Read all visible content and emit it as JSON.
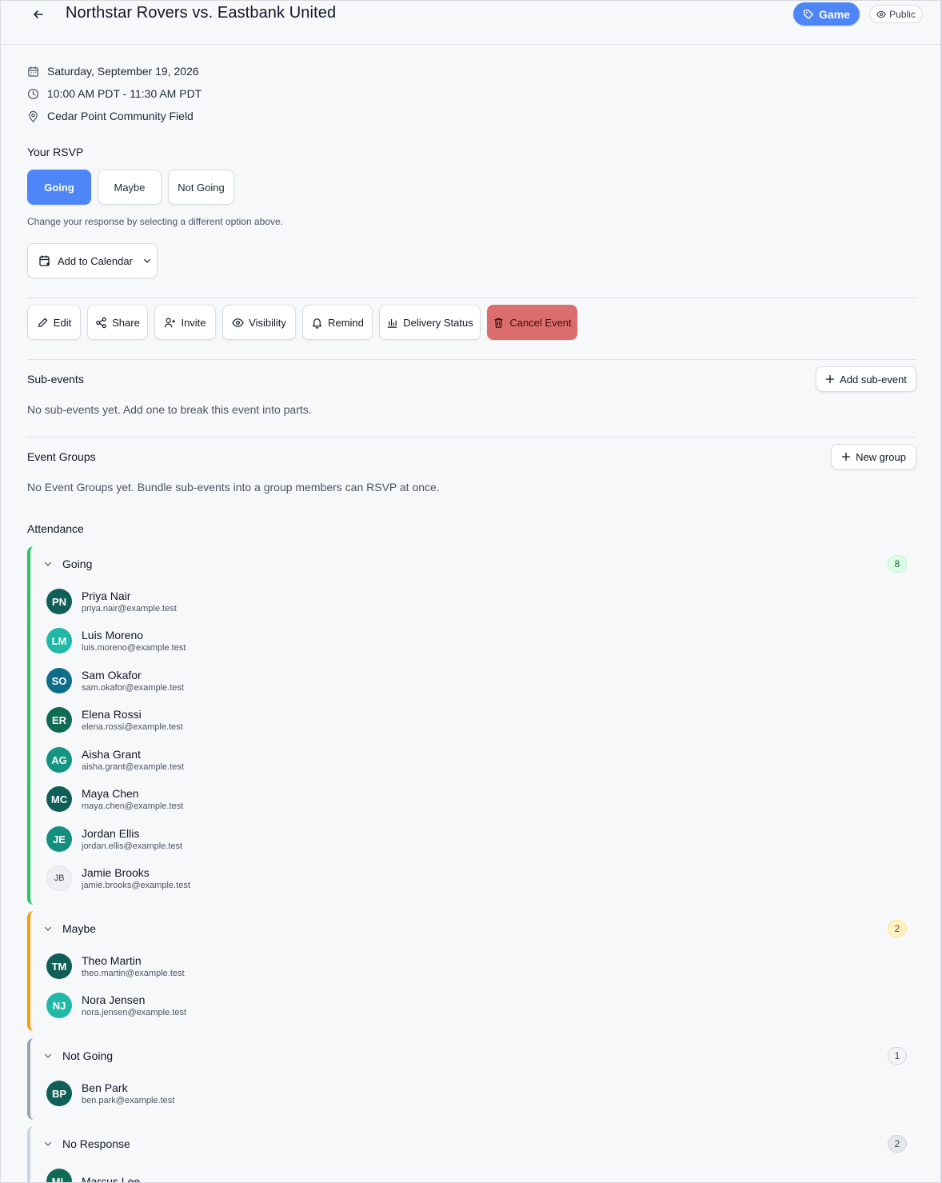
{
  "header": {
    "title": "Northstar Rovers vs. Eastbank United",
    "type_pill": "Game",
    "visibility_pill": "Public"
  },
  "meta": {
    "date": "Saturday, September 19, 2026",
    "time": "10:00 AM PDT - 11:30 AM PDT",
    "location": "Cedar Point Community Field"
  },
  "rsvp": {
    "label": "Your RSVP",
    "options": [
      "Going",
      "Maybe",
      "Not Going"
    ],
    "selected": "Going",
    "hint": "Change your response by selecting a different option above.",
    "calendar_button": "Add to Calendar"
  },
  "actions": {
    "edit": "Edit",
    "share": "Share",
    "invite": "Invite",
    "visibility": "Visibility",
    "remind": "Remind",
    "delivery_status": "Delivery Status",
    "cancel": "Cancel Event"
  },
  "subevents": {
    "title": "Sub-events",
    "empty": "No sub-events yet. Add one to break this event into parts.",
    "add_button": "Add sub-event"
  },
  "event_groups": {
    "title": "Event Groups",
    "empty": "No Event Groups yet. Bundle sub-events into a group members can RSVP at once.",
    "add_button": "New group"
  },
  "attendance": {
    "title": "Attendance",
    "groups": [
      {
        "label": "Going",
        "count": "8",
        "color": "#22c55e",
        "people": [
          {
            "initials": "PN",
            "name": "Priya Nair",
            "email": "priya.nair@example.test",
            "color": "#0f5e57"
          },
          {
            "initials": "LM",
            "name": "Luis Moreno",
            "email": "luis.moreno@example.test",
            "color": "#20b8a6"
          },
          {
            "initials": "SO",
            "name": "Sam Okafor",
            "email": "sam.okafor@example.test",
            "color": "#0e6e8a"
          },
          {
            "initials": "ER",
            "name": "Elena Rossi",
            "email": "elena.rossi@example.test",
            "color": "#0f6b55"
          },
          {
            "initials": "AG",
            "name": "Aisha Grant",
            "email": "aisha.grant@example.test",
            "color": "#169483"
          },
          {
            "initials": "MC",
            "name": "Maya Chen",
            "email": "maya.chen@example.test",
            "color": "#0f5e57"
          },
          {
            "initials": "JE",
            "name": "Jordan Ellis",
            "email": "jordan.ellis@example.test",
            "color": "#138f7f"
          },
          {
            "initials": "JB",
            "name": "Jamie Brooks",
            "email": "jamie.brooks@example.test",
            "color": "#eef0f3"
          }
        ]
      },
      {
        "label": "Maybe",
        "count": "2",
        "color": "#f59e0b",
        "people": [
          {
            "initials": "TM",
            "name": "Theo Martin",
            "email": "theo.martin@example.test",
            "color": "#0f5e57"
          },
          {
            "initials": "NJ",
            "name": "Nora Jensen",
            "email": "nora.jensen@example.test",
            "color": "#20b8a6"
          }
        ]
      },
      {
        "label": "Not Going",
        "count": "1",
        "color": "#9ca3af",
        "people": [
          {
            "initials": "BP",
            "name": "Ben Park",
            "email": "ben.park@example.test",
            "color": "#0f5e57"
          }
        ]
      },
      {
        "label": "No Response",
        "count": "2",
        "color": "#cbd5e1",
        "people": [
          {
            "initials": "ML",
            "name": "Marcus Lee",
            "email": "",
            "color": "#0f6b55"
          }
        ]
      }
    ]
  }
}
